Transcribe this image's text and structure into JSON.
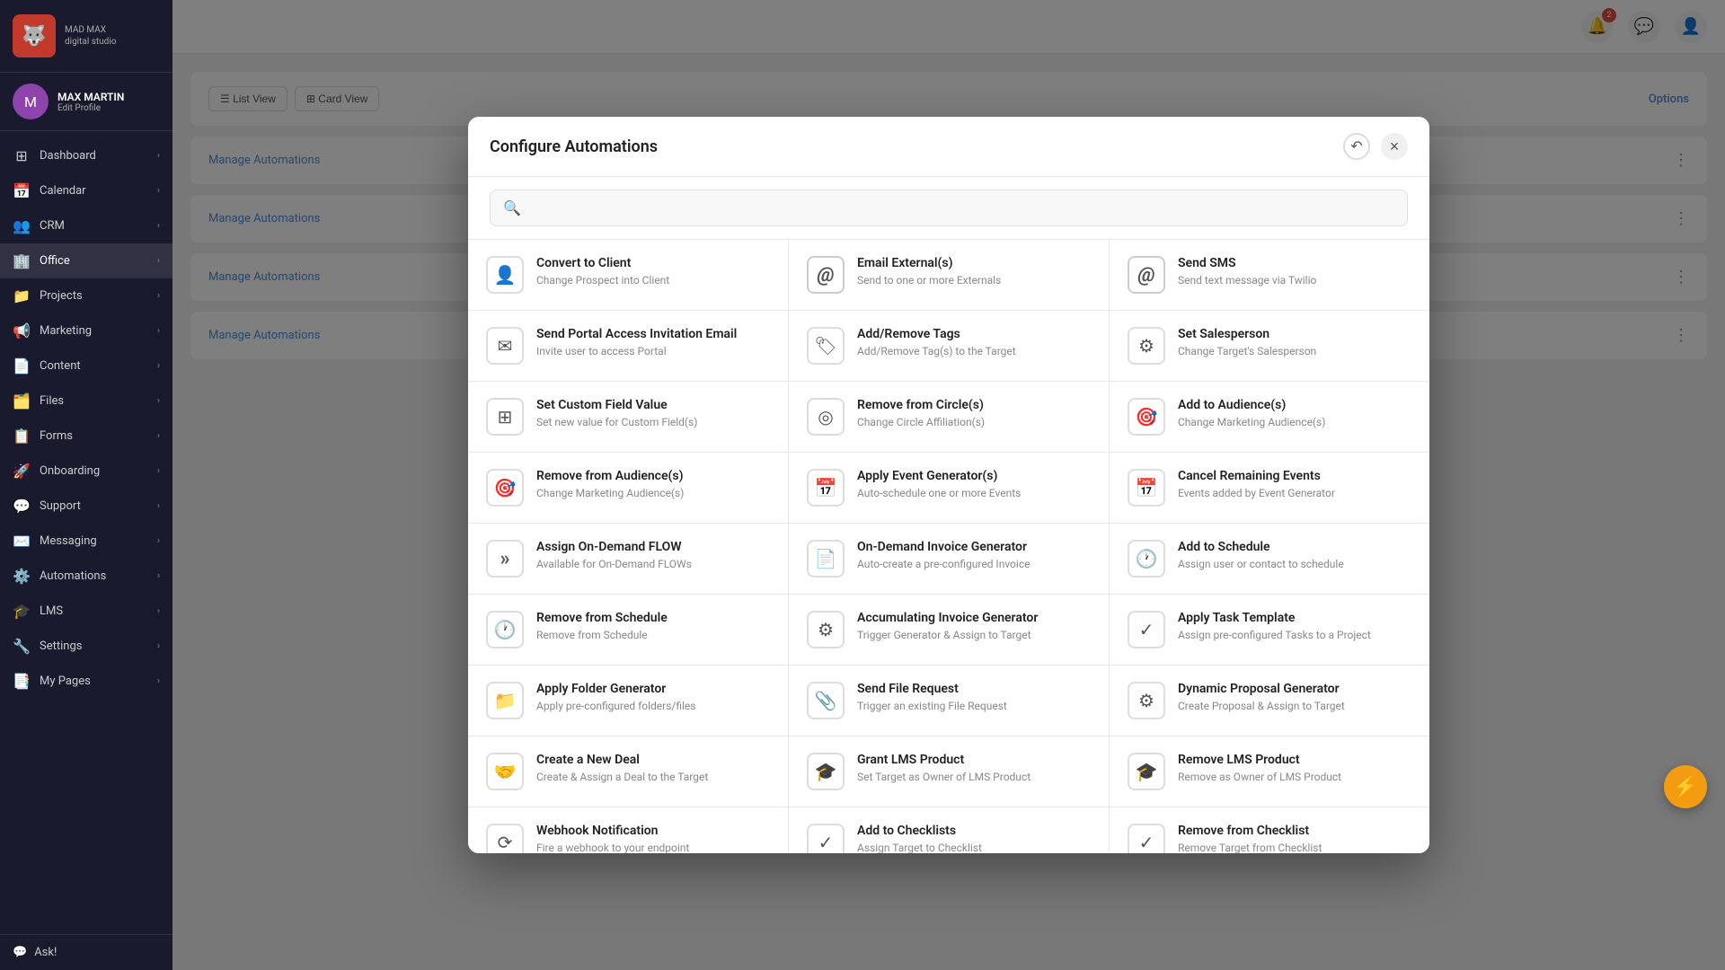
{
  "app": {
    "name": "MAD MAX",
    "subtitle": "digital studio"
  },
  "user": {
    "name": "MAX MARTIN",
    "edit_label": "Edit Profile"
  },
  "sidebar": {
    "items": [
      {
        "id": "dashboard",
        "label": "Dashboard",
        "icon": "⊞",
        "has_chevron": true
      },
      {
        "id": "calendar",
        "label": "Calendar",
        "icon": "📅",
        "has_chevron": true
      },
      {
        "id": "crm",
        "label": "CRM",
        "icon": "👥",
        "has_chevron": true
      },
      {
        "id": "office",
        "label": "Office",
        "icon": "🏢",
        "has_chevron": true,
        "active": true
      },
      {
        "id": "projects",
        "label": "Projects",
        "icon": "📁",
        "has_chevron": true
      },
      {
        "id": "marketing",
        "label": "Marketing",
        "icon": "📢",
        "has_chevron": true
      },
      {
        "id": "content",
        "label": "Content",
        "icon": "📄",
        "has_chevron": true
      },
      {
        "id": "files",
        "label": "Files",
        "icon": "🗂️",
        "has_chevron": true
      },
      {
        "id": "forms",
        "label": "Forms",
        "icon": "📋",
        "has_chevron": true
      },
      {
        "id": "onboarding",
        "label": "Onboarding",
        "icon": "🚀",
        "has_chevron": true
      },
      {
        "id": "support",
        "label": "Support",
        "icon": "💬",
        "has_chevron": true
      },
      {
        "id": "messaging",
        "label": "Messaging",
        "icon": "✉️",
        "has_chevron": true
      },
      {
        "id": "automations",
        "label": "Automations",
        "icon": "⚙️",
        "has_chevron": true
      },
      {
        "id": "lms",
        "label": "LMS",
        "icon": "🎓",
        "has_chevron": true
      },
      {
        "id": "settings",
        "label": "Settings",
        "icon": "🔧",
        "has_chevron": true
      },
      {
        "id": "my-pages",
        "label": "My Pages",
        "icon": "📑",
        "has_chevron": true
      }
    ],
    "footer": {
      "ask_label": "Ask!"
    }
  },
  "modal": {
    "title": "Configure Automations",
    "search_placeholder": "",
    "close_label": "×",
    "automations": [
      {
        "id": "convert-to-client",
        "name": "Convert to Client",
        "desc": "Change Prospect into Client",
        "icon": "👤"
      },
      {
        "id": "email-externals",
        "name": "Email External(s)",
        "desc": "Send to one or more Externals",
        "icon": "@"
      },
      {
        "id": "send-sms",
        "name": "Send SMS",
        "desc": "Send text message via Twilio",
        "icon": "@"
      },
      {
        "id": "send-portal-email",
        "name": "Send Portal Access Invitation Email",
        "desc": "Invite user to access Portal",
        "icon": "✉"
      },
      {
        "id": "add-remove-tags",
        "name": "Add/Remove Tags",
        "desc": "Add/Remove Tag(s) to the Target",
        "icon": "🏷"
      },
      {
        "id": "set-salesperson",
        "name": "Set Salesperson",
        "desc": "Change Target's Salesperson",
        "icon": "⚙"
      },
      {
        "id": "set-custom-field",
        "name": "Set Custom Field Value",
        "desc": "Set new value for Custom Field(s)",
        "icon": "⊞"
      },
      {
        "id": "remove-from-circles",
        "name": "Remove from Circle(s)",
        "desc": "Change Circle Affiliation(s)",
        "icon": "◎"
      },
      {
        "id": "add-to-audiences",
        "name": "Add to Audience(s)",
        "desc": "Change Marketing Audience(s)",
        "icon": "🎯"
      },
      {
        "id": "remove-from-audiences",
        "name": "Remove from Audience(s)",
        "desc": "Change Marketing Audience(s)",
        "icon": "🎯"
      },
      {
        "id": "apply-event-generator",
        "name": "Apply Event Generator(s)",
        "desc": "Auto-schedule one or more Events",
        "icon": "📅"
      },
      {
        "id": "cancel-remaining-events",
        "name": "Cancel Remaining Events",
        "desc": "Events added by Event Generator",
        "icon": "📅"
      },
      {
        "id": "assign-on-demand-flow",
        "name": "Assign On-Demand FLOW",
        "desc": "Available for On-Demand FLOWs",
        "icon": "»"
      },
      {
        "id": "on-demand-invoice",
        "name": "On-Demand Invoice Generator",
        "desc": "Auto-create a pre-configured Invoice",
        "icon": "📄"
      },
      {
        "id": "add-to-schedule",
        "name": "Add to Schedule",
        "desc": "Assign user or contact to schedule",
        "icon": "🕐"
      },
      {
        "id": "remove-from-schedule",
        "name": "Remove from Schedule",
        "desc": "Remove from Schedule",
        "icon": "🕐"
      },
      {
        "id": "accumulating-invoice",
        "name": "Accumulating Invoice Generator",
        "desc": "Trigger Generator & Assign to Target",
        "icon": "⚙"
      },
      {
        "id": "apply-task-template",
        "name": "Apply Task Template",
        "desc": "Assign pre-configured Tasks to a Project",
        "icon": "✓"
      },
      {
        "id": "apply-folder-generator",
        "name": "Apply Folder Generator",
        "desc": "Apply pre-configured folders/files",
        "icon": "📁"
      },
      {
        "id": "send-file-request",
        "name": "Send File Request",
        "desc": "Trigger an existing File Request",
        "icon": "📎"
      },
      {
        "id": "dynamic-proposal",
        "name": "Dynamic Proposal Generator",
        "desc": "Create Proposal & Assign to Target",
        "icon": "⚙"
      },
      {
        "id": "create-new-deal",
        "name": "Create a New Deal",
        "desc": "Create & Assign a Deal to the Target",
        "icon": "🤝"
      },
      {
        "id": "grant-lms-product",
        "name": "Grant LMS Product",
        "desc": "Set Target as Owner of LMS Product",
        "icon": "🎓"
      },
      {
        "id": "remove-lms-product",
        "name": "Remove LMS Product",
        "desc": "Remove as Owner of LMS Product",
        "icon": "🎓"
      },
      {
        "id": "webhook-notification",
        "name": "Webhook Notification",
        "desc": "Fire a webhook to your endpoint",
        "icon": "⟳"
      },
      {
        "id": "add-to-checklists",
        "name": "Add to Checklists",
        "desc": "Assign Target to Checklist",
        "icon": "✓"
      },
      {
        "id": "remove-from-checklist",
        "name": "Remove from Checklist",
        "desc": "Remove Target from Checklist",
        "icon": "✓"
      }
    ]
  },
  "content_rows": [
    {
      "label": "Manage Automations",
      "has_options": true
    },
    {
      "label": "Manage Automations",
      "has_options": true
    },
    {
      "label": "Manage Automations",
      "has_options": true
    },
    {
      "label": "Manage Automations",
      "has_options": true
    }
  ],
  "header": {
    "notification_count": "2",
    "view_list_label": "List View",
    "view_card_label": "Card View",
    "options_label": "Options"
  }
}
